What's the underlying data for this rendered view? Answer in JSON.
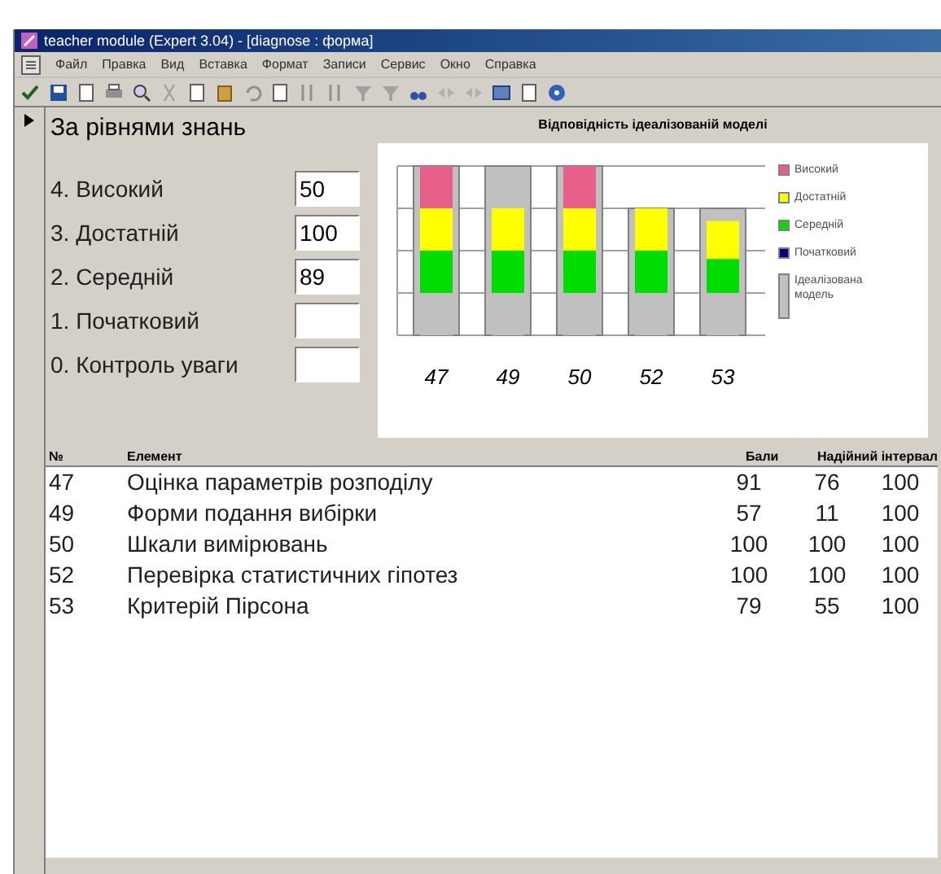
{
  "window": {
    "title": "teacher module (Expert 3.04) - [diagnose : форма]"
  },
  "menu": [
    "Файл",
    "Правка",
    "Вид",
    "Вставка",
    "Формат",
    "Записи",
    "Сервис",
    "Окно",
    "Справка"
  ],
  "form": {
    "selected_record": true,
    "heading": "За рівнями знань",
    "fields": [
      {
        "label": "4. Високий",
        "value": "50"
      },
      {
        "label": "3. Достатній",
        "value": "100"
      },
      {
        "label": "2. Середній",
        "value": "89"
      },
      {
        "label": "1. Початковий"
      },
      {
        "label": "0. Контроль уваги"
      }
    ]
  },
  "chart": {
    "title": "Відповідність ідеалізованій моделі",
    "categories": [
      "47",
      "49",
      "50",
      "52",
      "53"
    ],
    "legend": [
      {
        "label": "Високий",
        "color": "#e8608a"
      },
      {
        "label": "Достатній",
        "color": "#ffff00"
      },
      {
        "label": "Середній",
        "color": "#00dd00"
      },
      {
        "label": "Початковий",
        "color": "#000080"
      },
      {
        "label": "Ідеалізована модель",
        "color": "#c0c0c0"
      }
    ]
  },
  "table": {
    "columns": [
      "№",
      "Елемент",
      "Бали",
      "Надійний інтервал"
    ],
    "rows": [
      [
        "47",
        "Оцінка параметрів розподілу",
        "91",
        "76",
        "100"
      ],
      [
        "49",
        "Форми подання вибірки",
        "57",
        "11",
        "100"
      ],
      [
        "50",
        "Шкали вимірювань",
        "100",
        "100",
        "100"
      ],
      [
        "52",
        "Перевірка статистичних гіпотез",
        "100",
        "100",
        "100"
      ],
      [
        "53",
        "Критерій Пірсона",
        "79",
        "55",
        "100"
      ]
    ]
  }
}
